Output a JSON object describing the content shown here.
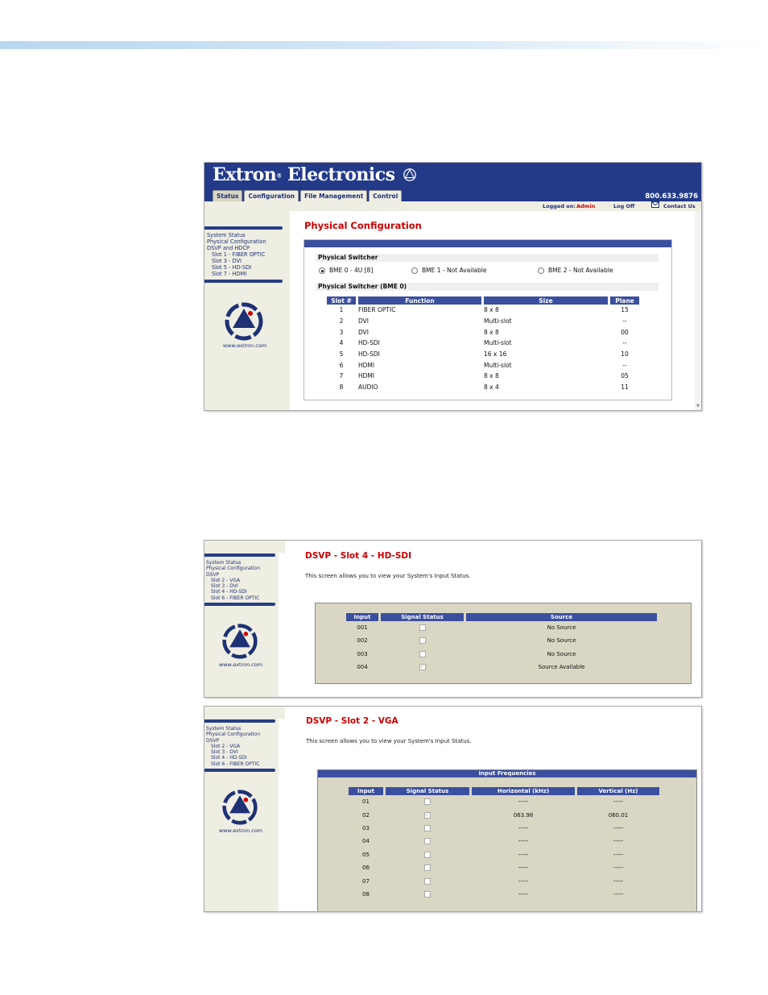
{
  "brand": {
    "name": "Extron",
    "suffix": "Electronics",
    "reg": "®"
  },
  "shot1": {
    "phone": "800.633.9876",
    "tabs": [
      "Status",
      "Configuration",
      "File Management",
      "Control"
    ],
    "logged_label": "Logged on:",
    "logged_user": "Admin",
    "logoff": "Log Off",
    "contact": "Contact Us",
    "nav": [
      "System Status",
      "Physical Configuration",
      "DSVP and HDCP",
      "Slot 1 - FIBER OPTIC",
      "Slot 3 - DVI",
      "Slot 5 - HD-SDI",
      "Slot 7 - HDMI"
    ],
    "url": "www.extron.com",
    "title": "Physical Configuration",
    "switcher_label": "Physical Switcher",
    "radios": [
      "BME 0 - 4U [8]",
      "BME 1 - Not Available",
      "BME 2 - Not Available"
    ],
    "switcher_bme_label": "Physical Switcher (BME 0)",
    "columns": [
      "Slot #",
      "Function",
      "Size",
      "Plane"
    ],
    "rows": [
      [
        "1",
        "FIBER OPTIC",
        "8 x 8",
        "15"
      ],
      [
        "2",
        "DVI",
        "Multi-slot",
        "--"
      ],
      [
        "3",
        "DVI",
        "8 x 8",
        "00"
      ],
      [
        "4",
        "HD-SDI",
        "Multi-slot",
        "--"
      ],
      [
        "5",
        "HD-SDI",
        "16 x 16",
        "10"
      ],
      [
        "6",
        "HDMI",
        "Multi-slot",
        "--"
      ],
      [
        "7",
        "HDMI",
        "8 x 8",
        "05"
      ],
      [
        "8",
        "AUDIO",
        "8 x 4",
        "11"
      ]
    ]
  },
  "shot2": {
    "nav": [
      "System Status",
      "Physical Configuration",
      "DSVP",
      "Slot 2 - VGA",
      "Slot 3 - DVI",
      "Slot 4 - HD-SDI",
      "Slot 6 - FIBER OPTIC"
    ],
    "url": "www.extron.com",
    "title": "DSVP - Slot 4 - HD-SDI",
    "desc": "This screen allows you to view your System's Input Status.",
    "columns": [
      "Input",
      "Signal Status",
      "Source"
    ],
    "rows": [
      {
        "input": "001",
        "checked": false,
        "source": "No Source"
      },
      {
        "input": "002",
        "checked": false,
        "source": "No Source"
      },
      {
        "input": "003",
        "checked": false,
        "source": "No Source"
      },
      {
        "input": "004",
        "checked": true,
        "source": "Source Available"
      }
    ]
  },
  "shot3": {
    "nav": [
      "System Status",
      "Physical Configuration",
      "DSVP",
      "Slot 2 - VGA",
      "Slot 3 - DVI",
      "Slot 4 - HD-SDI",
      "Slot 6 - FIBER OPTIC"
    ],
    "url": "www.extron.com",
    "title": "DSVP - Slot 2 - VGA",
    "desc": "This screen allows you to view your System's Input Status.",
    "table_title": "Input Frequencies",
    "columns": [
      "Input",
      "Signal Status",
      "Horizontal (kHz)",
      "Vertical (Hz)"
    ],
    "rows": [
      {
        "input": "01",
        "checked": false,
        "h": "-----",
        "v": "-----"
      },
      {
        "input": "02",
        "checked": true,
        "h": "063.98",
        "v": "060.01"
      },
      {
        "input": "03",
        "checked": false,
        "h": "-----",
        "v": "-----"
      },
      {
        "input": "04",
        "checked": false,
        "h": "-----",
        "v": "-----"
      },
      {
        "input": "05",
        "checked": false,
        "h": "-----",
        "v": "-----"
      },
      {
        "input": "06",
        "checked": false,
        "h": "-----",
        "v": "-----"
      },
      {
        "input": "07",
        "checked": false,
        "h": "-----",
        "v": "-----"
      },
      {
        "input": "08",
        "checked": false,
        "h": "-----",
        "v": "-----"
      }
    ]
  }
}
